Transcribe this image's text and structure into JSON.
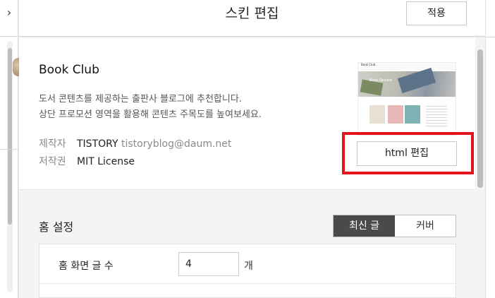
{
  "header": {
    "title": "스킨 편집",
    "apply_label": "적용",
    "collapse_glyph": "›"
  },
  "skin": {
    "name": "Book Club",
    "description_line1": "도서 콘텐츠를 제공하는 출판사 블로그에 추천합니다.",
    "description_line2": "상단 프로모션 영역을 활용해 콘텐츠 주목도를 높여보세요.",
    "creator_label": "제작자",
    "creator_name": "TISTORY",
    "creator_email": "tistoryblog@daum.net",
    "license_label": "저작권",
    "license_value": "MIT License",
    "thumbnail": {
      "brand": "Book Club",
      "caption": "Book Review"
    },
    "html_edit_label": "html 편집",
    "highlight_color": "#e3141d"
  },
  "home_settings": {
    "title": "홈 설정",
    "tabs": [
      {
        "label": "최신 글",
        "active": true
      },
      {
        "label": "커버",
        "active": false
      }
    ],
    "rows": [
      {
        "label": "홈 화면 글 수",
        "value": "4",
        "unit": "개"
      }
    ]
  },
  "icons": {
    "collapse": "chevron-right-icon"
  }
}
